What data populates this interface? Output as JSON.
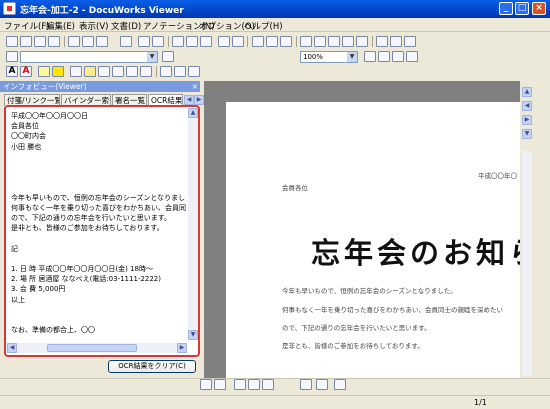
{
  "window": {
    "title": "忘年会-加工-2 - DocuWorks Viewer"
  },
  "menu": [
    "ファイル(F)",
    "編集(E)",
    "表示(V)",
    "文書(D)",
    "アノテーション(N)",
    "オプション(O)",
    "ヘルプ(H)"
  ],
  "toolbar": {
    "zoom_value": "100%"
  },
  "panel": {
    "header": "インフォビュー(Viewer)",
    "tabs": [
      "付箋/リンク一覧",
      "バインダー索引",
      "署名一覧",
      "OCR結果"
    ],
    "ocr_lines": [
      "平成〇〇年〇〇月〇〇日",
      "会員各位",
      "〇〇町内会",
      "小田 勝也",
      "",
      "",
      "",
      "",
      "今年も早いもので、恒例の忘年会のシーズンとなりました。",
      "何事もなく一年を乗り切った喜びをわかちあい、会員同士の親",
      "ので、下記の通りの忘年会を行いたいと思います。",
      "是非とも、皆様のご参加をお待ちしております。",
      "",
      "記",
      "",
      "1. 日 時  平成〇〇年〇〇月〇〇日(金) 18時〜",
      "2. 場 所  居酒屋 ななべえ(電話:03-1111-2222)",
      "3. 会 費  5,000円",
      "以上",
      "",
      "",
      "なお、準備の都合上、〇〇"
    ],
    "clear_button": "OCR結果をクリア(C)"
  },
  "document": {
    "date": "平成〇〇年〇",
    "recipient": "会員各位",
    "heading": "忘年会のお知らせ",
    "body": [
      "今年も早いもので、恒例の忘年会のシーズンとなりました。",
      "何事もなく一年を乗り切った喜びをわかちあい、会員同士の親睦を深めたい",
      "ので、下記の通りの忘年会を行いたいと思います。",
      "是非とも、皆様のご参加をお待ちしております。"
    ]
  },
  "status": {
    "page": "1/1"
  }
}
